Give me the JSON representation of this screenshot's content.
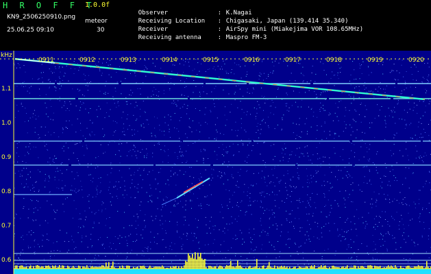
{
  "header": {
    "title": "H R O F F T",
    "fft_label": "1.0.0f",
    "filename": "KN9_2506250910.png",
    "mode": "meteor",
    "datetime": "25.06.25 09:10",
    "interval": "30"
  },
  "info": [
    {
      "label": "Observer",
      "value": "K.Nagai"
    },
    {
      "label": "Receiving Location",
      "value": "Chigasaki, Japan (139.414 35.340)"
    },
    {
      "label": "Receiver",
      "value": "AirSpy mini (Miakejima VOR 108.65MHz)"
    },
    {
      "label": "Receiving antenna",
      "value": "Maspro FM-3"
    }
  ],
  "spectrogram": {
    "y_unit": "kHz",
    "y_ticks": [
      "1.1",
      "1.0",
      "0.9",
      "0.8",
      "0.7",
      "0.6"
    ],
    "x_ticks": [
      "0911",
      "0912",
      "0913",
      "0914",
      "0915",
      "0916",
      "0917",
      "0918",
      "0919",
      "0920"
    ],
    "colors": {
      "background": "#00008b",
      "axis": "#ffff33",
      "noise": "#4a6cff"
    }
  }
}
